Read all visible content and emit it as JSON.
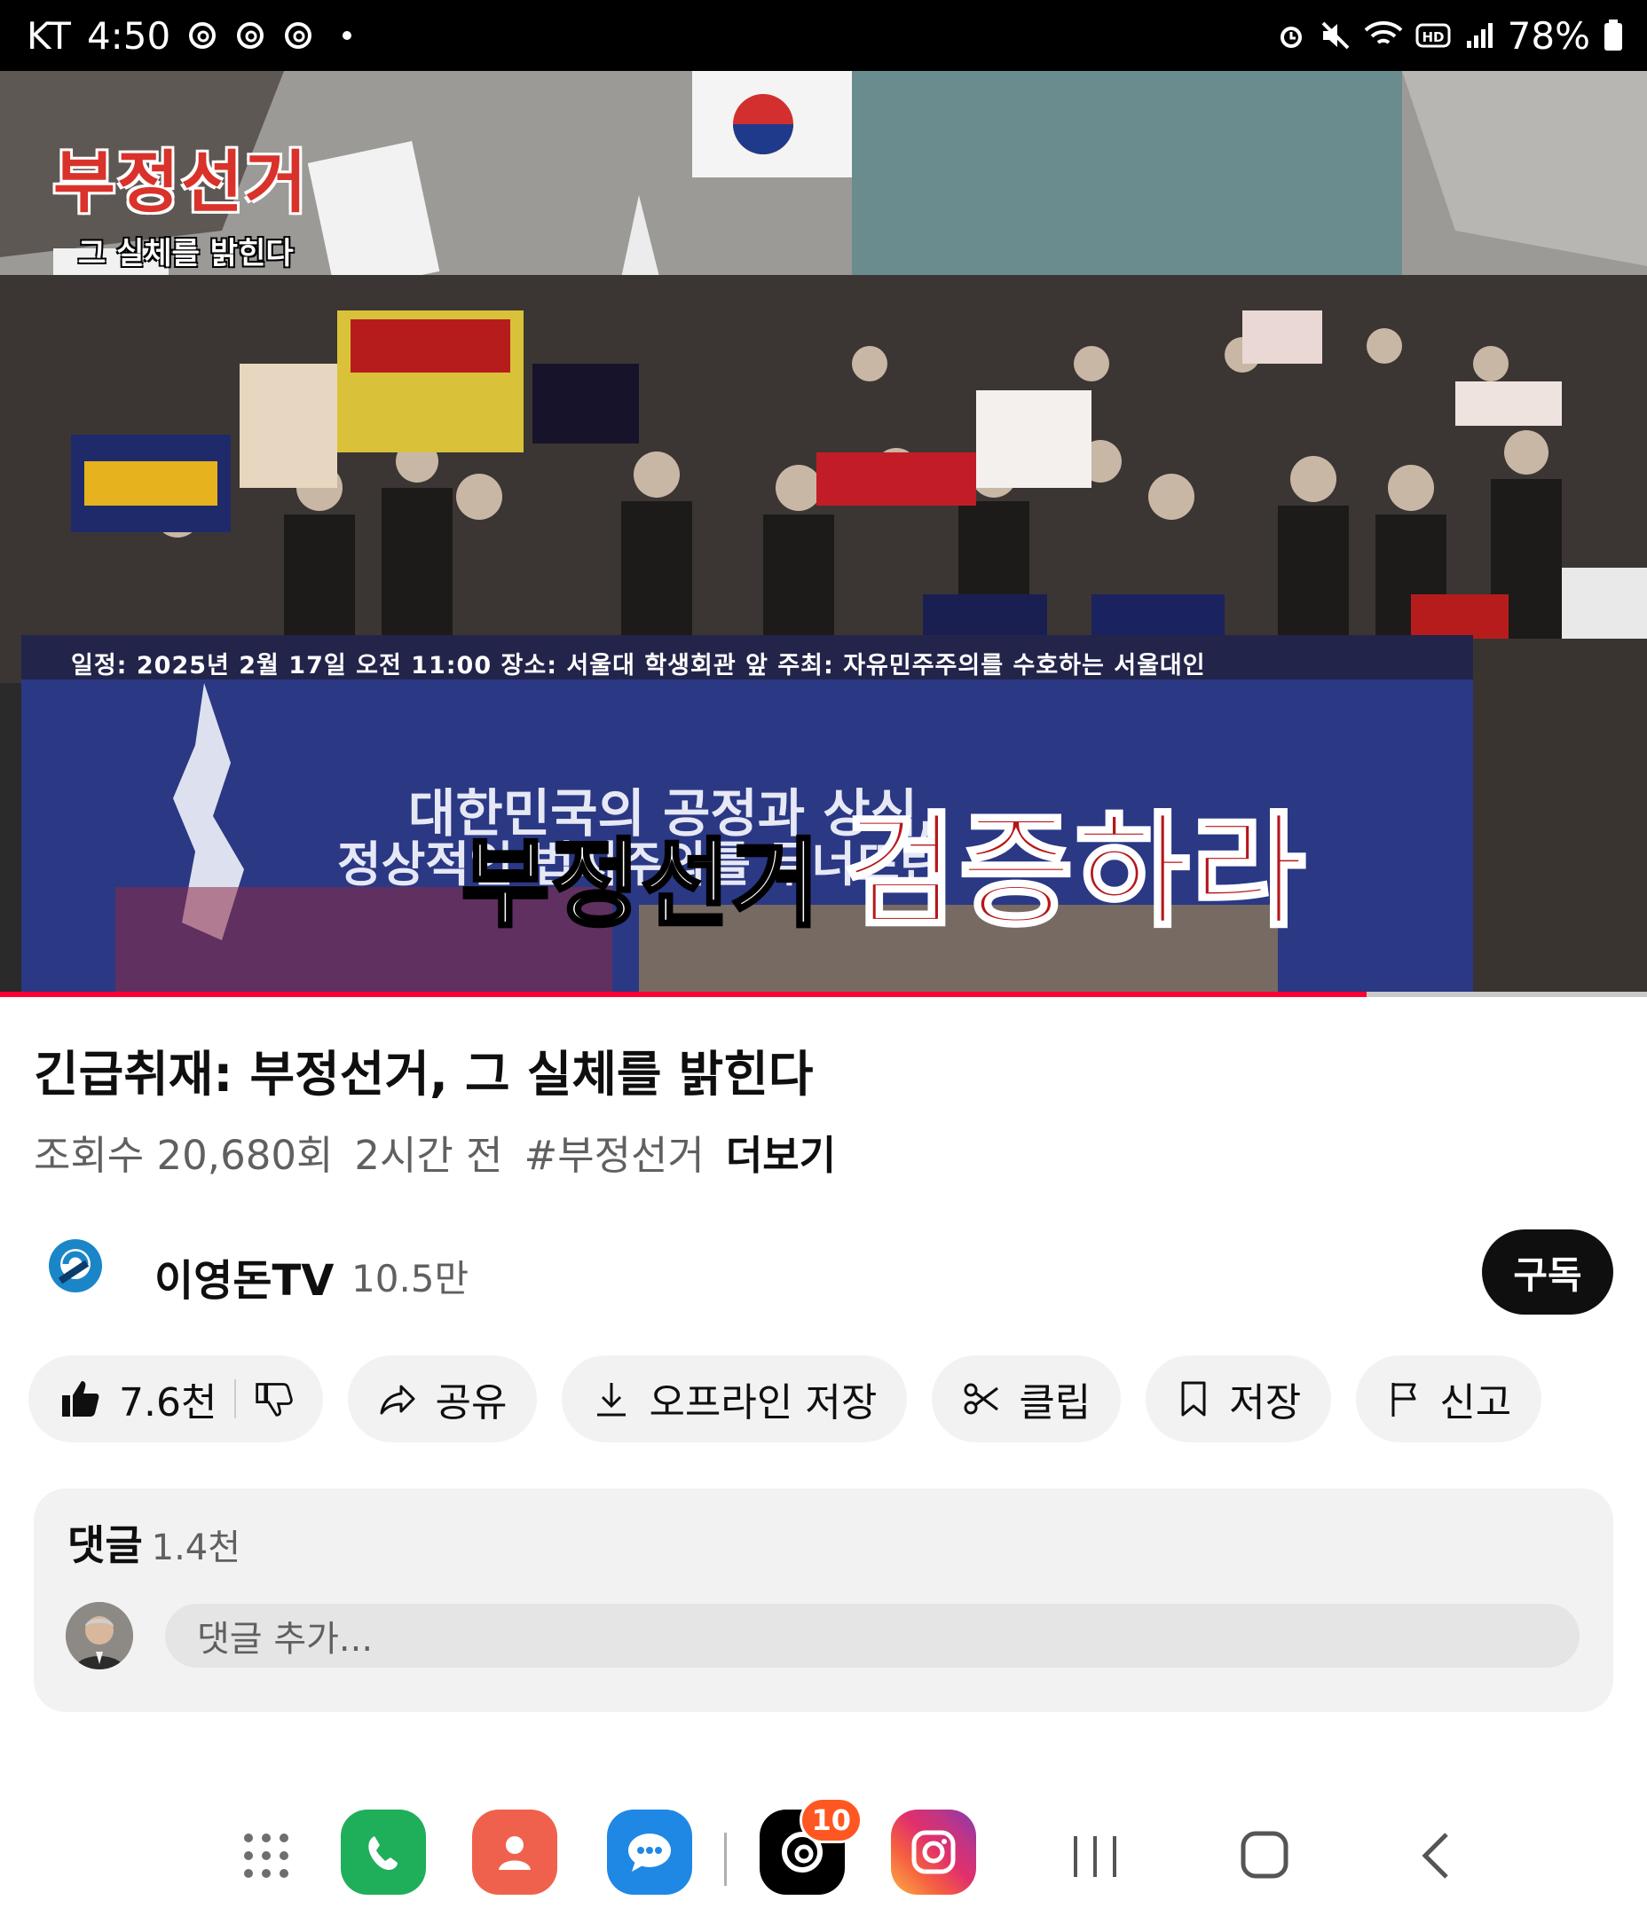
{
  "status_bar": {
    "carrier": "KT",
    "time": "4:50",
    "battery": "78%",
    "icons": [
      "threads-icon",
      "threads-icon",
      "threads-icon",
      "alarm-icon",
      "mute-icon",
      "wifi-icon",
      "hd-icon",
      "signal-icon",
      "battery-icon"
    ]
  },
  "video": {
    "overlay_title_line1": "부정선거",
    "overlay_title_line2": "그 실체를 밝힌다",
    "banner_info": "일정: 2025년 2월 17일 오전 11:00   장소: 서울대 학생회관 앞   주최: 자유민주주의를 수호하는 서울대인",
    "banner_line1": "대한민국의 공정과 상식,",
    "banner_line2": "정상적인 법치주의를 무너뜨린",
    "caption_white": "부정선거",
    "caption_red": "검증하라",
    "progress": 0.83
  },
  "info": {
    "title": "긴급취재: 부정선거, 그 실체를 밝힌다",
    "views": "조회수 20,680회",
    "age": "2시간 전",
    "hashtag": "#부정선거",
    "more": "더보기"
  },
  "channel": {
    "name": "이영돈TV",
    "subscribers": "10.5만",
    "subscribe_label": "구독"
  },
  "actions": {
    "like_count": "7.6천",
    "share": "공유",
    "download": "오프라인 저장",
    "clip": "클립",
    "save": "저장",
    "report": "신고"
  },
  "comments": {
    "label": "댓글",
    "count": "1.4천",
    "placeholder": "댓글 추가..."
  },
  "navbar": {
    "threads_badge": "10",
    "apps": [
      "apps-grid-icon",
      "phone-app-icon",
      "contacts-app-icon",
      "messages-app-icon",
      "threads-app-icon",
      "instagram-app-icon",
      "recents-icon",
      "home-icon",
      "back-icon"
    ]
  },
  "colors": {
    "progress": "#ff0033",
    "subscribe_bg": "#0f0f0f",
    "pill_bg": "#f2f2f2",
    "threads_badge": "#ff5722"
  }
}
